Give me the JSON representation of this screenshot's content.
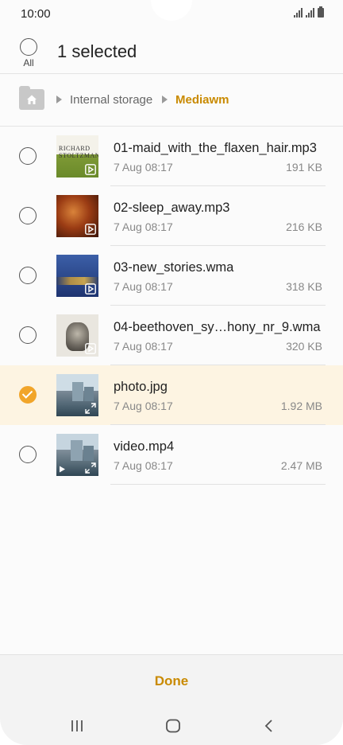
{
  "status": {
    "time": "10:00"
  },
  "header": {
    "all_label": "All",
    "title": "1 selected"
  },
  "breadcrumb": {
    "items": [
      "Internal storage",
      "Mediawm"
    ]
  },
  "files": [
    {
      "name": "01-maid_with_the_flaxen_hair.mp3",
      "date": "7 Aug 08:17",
      "size": "191 KB",
      "selected": false,
      "thumb_text": "RICHARD STOLTZMAN"
    },
    {
      "name": "02-sleep_away.mp3",
      "date": "7 Aug 08:17",
      "size": "216 KB",
      "selected": false
    },
    {
      "name": "03-new_stories.wma",
      "date": "7 Aug 08:17",
      "size": "318 KB",
      "selected": false
    },
    {
      "name": "04-beethoven_sy…hony_nr_9.wma",
      "date": "7 Aug 08:17",
      "size": "320 KB",
      "selected": false
    },
    {
      "name": "photo.jpg",
      "date": "7 Aug 08:17",
      "size": "1.92 MB",
      "selected": true
    },
    {
      "name": "video.mp4",
      "date": "7 Aug 08:17",
      "size": "2.47 MB",
      "selected": false
    }
  ],
  "footer": {
    "done_label": "Done"
  },
  "colors": {
    "accent": "#c98a00",
    "check": "#f1a52a",
    "selected_row": "#fdf4e2"
  }
}
